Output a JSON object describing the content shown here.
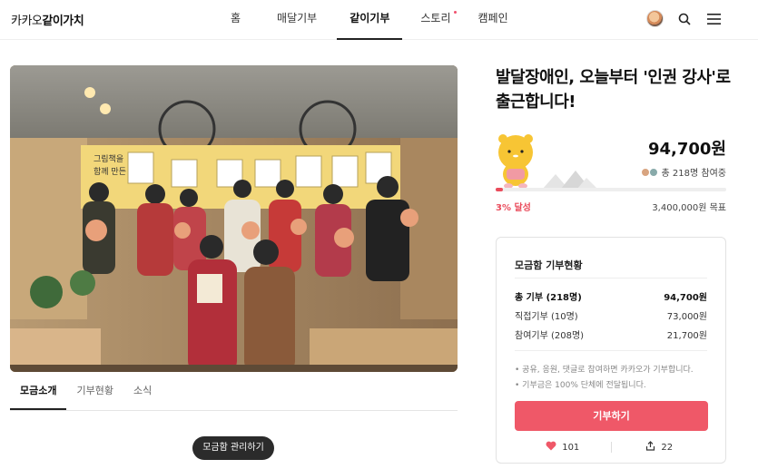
{
  "header": {
    "logo_pre": "카카오",
    "logo_bold": "같이가치",
    "nav": [
      "홈",
      "매달기부",
      "같이기부",
      "스토리",
      "캠페인"
    ]
  },
  "tabs": [
    "모금소개",
    "기부현황",
    "소식"
  ],
  "manage_button": "모금함 관리하기",
  "campaign": {
    "title": "발달장애인, 오늘부터 '인권 강사'로 출근합니다!",
    "amount": "94,700원",
    "participants": "총 218명 참여중",
    "progress_percent": 3,
    "rate_label": "3% 달성",
    "goal": "3,400,000원 목표"
  },
  "status_card": {
    "title": "모금함 기부현황",
    "rows": [
      {
        "label": "총 기부 (218명)",
        "value": "94,700원"
      },
      {
        "label": "직접기부 (10명)",
        "value": "73,000원"
      },
      {
        "label": "참여기부 (208명)",
        "value": "21,700원"
      }
    ],
    "notes": [
      "• 공유, 응원, 댓글로 참여하면 카카오가 기부합니다.",
      "• 기부금은 100% 단체에 전달됩니다."
    ],
    "donate_label": "기부하기",
    "likes": "101",
    "shares": "22"
  },
  "colors": {
    "accent": "#ef5868",
    "progress": "#ea4c5c"
  },
  "banner_text": "그림책을 함께 만든"
}
